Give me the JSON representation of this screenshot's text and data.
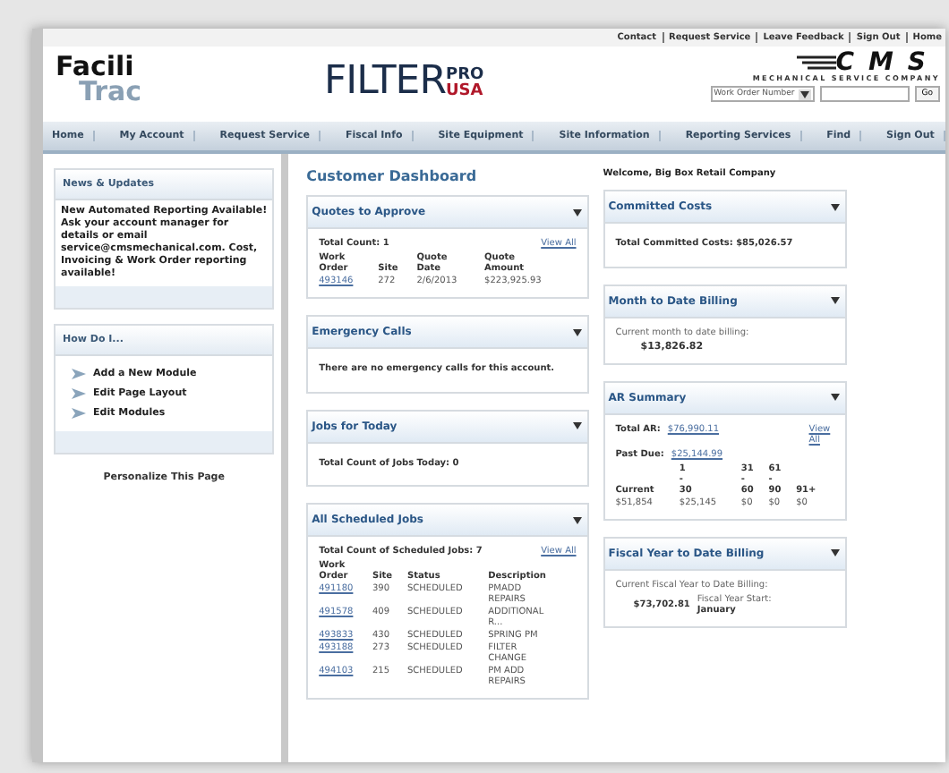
{
  "top_links": [
    "Contact",
    "Request Service",
    "Leave Feedback",
    "Sign Out",
    "Home"
  ],
  "logo": {
    "line1": "Facili",
    "line2": "Trac"
  },
  "brand": {
    "word": "FILTER",
    "pro": "PRO",
    "usa": "USA"
  },
  "company": {
    "name": "CMS",
    "tagline": "MECHANICAL SERVICE COMPANY"
  },
  "search": {
    "select": "Work Order Number",
    "button": "Go"
  },
  "nav": [
    "Home",
    "My Account",
    "Request Service",
    "Fiscal Info",
    "Site Equipment",
    "Site Information",
    "Reporting Services",
    "Find",
    "Sign Out"
  ],
  "sidebar": {
    "panels": [
      {
        "title": "News & Updates",
        "kind": "text",
        "text": "New Automated Reporting Available! Ask your account manager for details or email service@cmsmechanical.com. Cost, Invoicing & Work Order reporting available!"
      },
      {
        "title": "How Do I...",
        "kind": "links",
        "links": [
          "Add a New Module",
          "Edit Page Layout",
          "Edit Modules"
        ]
      }
    ],
    "footer": "Personalize This Page"
  },
  "dashboard": {
    "title": "Customer Dashboard",
    "panels": [
      {
        "title": "Quotes to Approve",
        "blocks": [
          {
            "kind": "link_line",
            "label": "Total Count: 1",
            "more": "View All"
          },
          {
            "kind": "table",
            "linked_first": true,
            "columns": [
              "Work Order",
              "Site",
              "Quote Date",
              "Quote Amount"
            ],
            "rows": [
              [
                "493146",
                "272",
                "2/6/2013",
                "$223,925.93"
              ]
            ]
          }
        ]
      },
      {
        "title": "Emergency Calls",
        "blocks": [
          {
            "kind": "note",
            "text": "There are no emergency calls for this account."
          }
        ]
      },
      {
        "title": "Jobs for Today",
        "blocks": [
          {
            "kind": "note",
            "text": "Total Count of Jobs Today: 0"
          }
        ]
      },
      {
        "title": "All Scheduled Jobs",
        "blocks": [
          {
            "kind": "link_line",
            "label": "Total Count of Scheduled Jobs: 7",
            "more": "View All"
          },
          {
            "kind": "table",
            "linked_first": true,
            "columns": [
              "Work Order",
              "Site",
              "Status",
              "Description"
            ],
            "rows": [
              [
                "491180",
                "390",
                "SCHEDULED",
                "PMADD REPAIRS"
              ],
              [
                "491578",
                "409",
                "SCHEDULED",
                "ADDITIONAL R..."
              ],
              [
                "493833",
                "430",
                "SCHEDULED",
                "SPRING PM"
              ],
              [
                "493188",
                "273",
                "SCHEDULED",
                "FILTER CHANGE"
              ],
              [
                "494103",
                "215",
                "SCHEDULED",
                "PM ADD REPAIRS"
              ]
            ]
          }
        ]
      }
    ]
  },
  "right": {
    "welcome": "Welcome, Big Box Retail Company",
    "panels": [
      {
        "title": "Committed Costs",
        "blocks": [
          {
            "kind": "note",
            "text": "Total Committed Costs: $85,026.57"
          }
        ]
      },
      {
        "title": "Month to Date Billing",
        "blocks": [
          {
            "kind": "caption",
            "text": "Current month to date billing:"
          },
          {
            "kind": "figure",
            "text": "$13,826.82"
          }
        ]
      },
      {
        "title": "AR Summary",
        "blocks": [
          {
            "kind": "link_line",
            "label": "Total AR:",
            "value": "$76,990.11",
            "more": "View All"
          },
          {
            "kind": "link_line",
            "label": "Past Due:",
            "value": "$25,144.99"
          },
          {
            "kind": "table",
            "linked_first": false,
            "columns": [
              "Current",
              "1 - 30",
              "31 - 60",
              "61 - 90",
              "91+"
            ],
            "rows": [
              [
                "$51,854",
                "$25,145",
                "$0",
                "$0",
                "$0"
              ]
            ]
          }
        ]
      },
      {
        "title": "Fiscal Year to Date Billing",
        "blocks": [
          {
            "kind": "caption",
            "text": "Current Fiscal Year to Date Billing:"
          },
          {
            "kind": "split",
            "value": "$73,702.81",
            "label": "Fiscal Year Start:",
            "sub": "January"
          }
        ]
      }
    ]
  }
}
